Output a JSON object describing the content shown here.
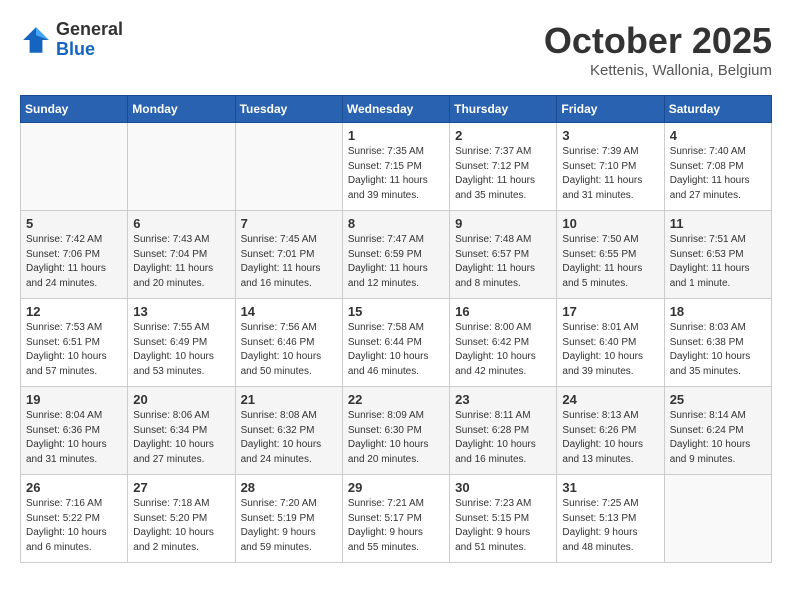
{
  "header": {
    "logo_general": "General",
    "logo_blue": "Blue",
    "month_title": "October 2025",
    "subtitle": "Kettenis, Wallonia, Belgium"
  },
  "days_of_week": [
    "Sunday",
    "Monday",
    "Tuesday",
    "Wednesday",
    "Thursday",
    "Friday",
    "Saturday"
  ],
  "weeks": [
    [
      {
        "day": "",
        "info": ""
      },
      {
        "day": "",
        "info": ""
      },
      {
        "day": "",
        "info": ""
      },
      {
        "day": "1",
        "info": "Sunrise: 7:35 AM\nSunset: 7:15 PM\nDaylight: 11 hours\nand 39 minutes."
      },
      {
        "day": "2",
        "info": "Sunrise: 7:37 AM\nSunset: 7:12 PM\nDaylight: 11 hours\nand 35 minutes."
      },
      {
        "day": "3",
        "info": "Sunrise: 7:39 AM\nSunset: 7:10 PM\nDaylight: 11 hours\nand 31 minutes."
      },
      {
        "day": "4",
        "info": "Sunrise: 7:40 AM\nSunset: 7:08 PM\nDaylight: 11 hours\nand 27 minutes."
      }
    ],
    [
      {
        "day": "5",
        "info": "Sunrise: 7:42 AM\nSunset: 7:06 PM\nDaylight: 11 hours\nand 24 minutes."
      },
      {
        "day": "6",
        "info": "Sunrise: 7:43 AM\nSunset: 7:04 PM\nDaylight: 11 hours\nand 20 minutes."
      },
      {
        "day": "7",
        "info": "Sunrise: 7:45 AM\nSunset: 7:01 PM\nDaylight: 11 hours\nand 16 minutes."
      },
      {
        "day": "8",
        "info": "Sunrise: 7:47 AM\nSunset: 6:59 PM\nDaylight: 11 hours\nand 12 minutes."
      },
      {
        "day": "9",
        "info": "Sunrise: 7:48 AM\nSunset: 6:57 PM\nDaylight: 11 hours\nand 8 minutes."
      },
      {
        "day": "10",
        "info": "Sunrise: 7:50 AM\nSunset: 6:55 PM\nDaylight: 11 hours\nand 5 minutes."
      },
      {
        "day": "11",
        "info": "Sunrise: 7:51 AM\nSunset: 6:53 PM\nDaylight: 11 hours\nand 1 minute."
      }
    ],
    [
      {
        "day": "12",
        "info": "Sunrise: 7:53 AM\nSunset: 6:51 PM\nDaylight: 10 hours\nand 57 minutes."
      },
      {
        "day": "13",
        "info": "Sunrise: 7:55 AM\nSunset: 6:49 PM\nDaylight: 10 hours\nand 53 minutes."
      },
      {
        "day": "14",
        "info": "Sunrise: 7:56 AM\nSunset: 6:46 PM\nDaylight: 10 hours\nand 50 minutes."
      },
      {
        "day": "15",
        "info": "Sunrise: 7:58 AM\nSunset: 6:44 PM\nDaylight: 10 hours\nand 46 minutes."
      },
      {
        "day": "16",
        "info": "Sunrise: 8:00 AM\nSunset: 6:42 PM\nDaylight: 10 hours\nand 42 minutes."
      },
      {
        "day": "17",
        "info": "Sunrise: 8:01 AM\nSunset: 6:40 PM\nDaylight: 10 hours\nand 39 minutes."
      },
      {
        "day": "18",
        "info": "Sunrise: 8:03 AM\nSunset: 6:38 PM\nDaylight: 10 hours\nand 35 minutes."
      }
    ],
    [
      {
        "day": "19",
        "info": "Sunrise: 8:04 AM\nSunset: 6:36 PM\nDaylight: 10 hours\nand 31 minutes."
      },
      {
        "day": "20",
        "info": "Sunrise: 8:06 AM\nSunset: 6:34 PM\nDaylight: 10 hours\nand 27 minutes."
      },
      {
        "day": "21",
        "info": "Sunrise: 8:08 AM\nSunset: 6:32 PM\nDaylight: 10 hours\nand 24 minutes."
      },
      {
        "day": "22",
        "info": "Sunrise: 8:09 AM\nSunset: 6:30 PM\nDaylight: 10 hours\nand 20 minutes."
      },
      {
        "day": "23",
        "info": "Sunrise: 8:11 AM\nSunset: 6:28 PM\nDaylight: 10 hours\nand 16 minutes."
      },
      {
        "day": "24",
        "info": "Sunrise: 8:13 AM\nSunset: 6:26 PM\nDaylight: 10 hours\nand 13 minutes."
      },
      {
        "day": "25",
        "info": "Sunrise: 8:14 AM\nSunset: 6:24 PM\nDaylight: 10 hours\nand 9 minutes."
      }
    ],
    [
      {
        "day": "26",
        "info": "Sunrise: 7:16 AM\nSunset: 5:22 PM\nDaylight: 10 hours\nand 6 minutes."
      },
      {
        "day": "27",
        "info": "Sunrise: 7:18 AM\nSunset: 5:20 PM\nDaylight: 10 hours\nand 2 minutes."
      },
      {
        "day": "28",
        "info": "Sunrise: 7:20 AM\nSunset: 5:19 PM\nDaylight: 9 hours\nand 59 minutes."
      },
      {
        "day": "29",
        "info": "Sunrise: 7:21 AM\nSunset: 5:17 PM\nDaylight: 9 hours\nand 55 minutes."
      },
      {
        "day": "30",
        "info": "Sunrise: 7:23 AM\nSunset: 5:15 PM\nDaylight: 9 hours\nand 51 minutes."
      },
      {
        "day": "31",
        "info": "Sunrise: 7:25 AM\nSunset: 5:13 PM\nDaylight: 9 hours\nand 48 minutes."
      },
      {
        "day": "",
        "info": ""
      }
    ]
  ]
}
